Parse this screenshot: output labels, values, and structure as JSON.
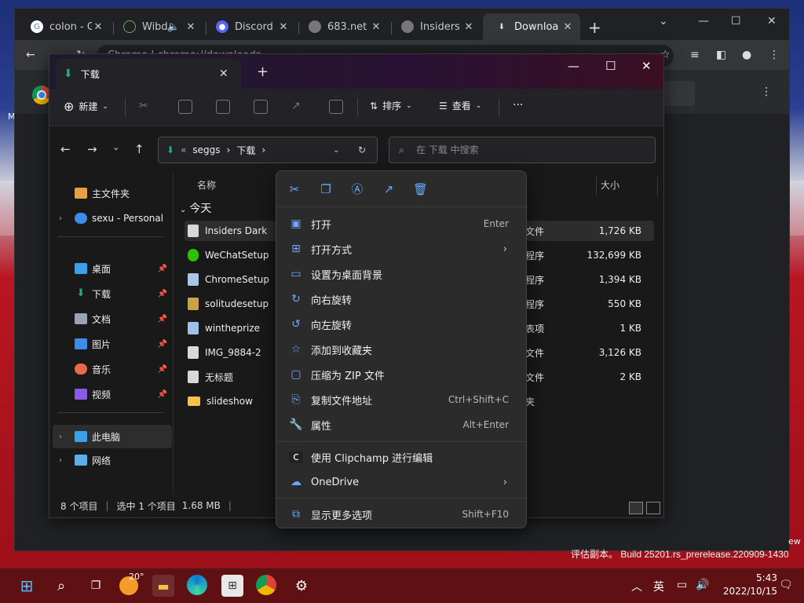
{
  "chrome": {
    "tabs": [
      {
        "label": "colon - G",
        "icon": "google-icon"
      },
      {
        "label": "Wibd",
        "icon": "wibdev-icon"
      },
      {
        "label": "Discord |",
        "icon": "discord-icon"
      },
      {
        "label": "683.net",
        "icon": "globe-icon"
      },
      {
        "label": "Insiders I",
        "icon": "globe-icon"
      },
      {
        "label": "Downloa",
        "icon": "download-icon"
      }
    ],
    "omnibox": "Chrome  |  chrome://downloads"
  },
  "explorer": {
    "tab_title": "下载",
    "toolbar": {
      "new_label": "新建",
      "sort_label": "排序",
      "view_label": "查看",
      "more_label": "···"
    },
    "breadcrumb": {
      "prefix": "«",
      "parts": [
        "seggs",
        "下载"
      ]
    },
    "search_placeholder": "在 下载 中搜索",
    "nav": {
      "home": "主文件夹",
      "onedrive": "sexu - Personal",
      "quick": [
        {
          "label": "桌面",
          "color": "#3aa0e8"
        },
        {
          "label": "下载",
          "color": "#1fb37a"
        },
        {
          "label": "文档",
          "color": "#9aa3b3"
        },
        {
          "label": "图片",
          "color": "#3a8ee8"
        },
        {
          "label": "音乐",
          "color": "#e86a4a"
        },
        {
          "label": "视频",
          "color": "#8a5ae8"
        }
      ],
      "thispc": "此电脑",
      "network": "网络"
    },
    "columns": {
      "name": "名称",
      "size": "大小"
    },
    "group": "今天",
    "files": [
      {
        "name": "Insiders Dark",
        "type": "文件",
        "size": "1,726 KB"
      },
      {
        "name": "WeChatSetup",
        "type": "程序",
        "size": "132,699 KB"
      },
      {
        "name": "ChromeSetup",
        "type": "程序",
        "size": "1,394 KB"
      },
      {
        "name": "solitudesetup",
        "type": "程序",
        "size": "550 KB"
      },
      {
        "name": "wintheprize",
        "type": "表项",
        "size": "1 KB"
      },
      {
        "name": "IMG_9884-2",
        "type": "文件",
        "size": "3,126 KB"
      },
      {
        "name": "无标题",
        "type": "文件",
        "size": "2 KB"
      },
      {
        "name": "slideshow",
        "type": "夹",
        "size": ""
      }
    ],
    "status": {
      "count": "8 个项目",
      "selected": "选中 1 个项目",
      "size": "1.68 MB"
    }
  },
  "context_menu": {
    "items": [
      {
        "label": "打开",
        "shortcut": "Enter",
        "icon": "image-icon"
      },
      {
        "label": "打开方式",
        "shortcut": "",
        "icon": "open-with-icon",
        "submenu": true
      },
      {
        "label": "设置为桌面背景",
        "shortcut": "",
        "icon": "wallpaper-icon"
      },
      {
        "label": "向右旋转",
        "shortcut": "",
        "icon": "rotate-right-icon"
      },
      {
        "label": "向左旋转",
        "shortcut": "",
        "icon": "rotate-left-icon"
      },
      {
        "label": "添加到收藏夹",
        "shortcut": "",
        "icon": "star-icon"
      },
      {
        "label": "压缩为 ZIP 文件",
        "shortcut": "",
        "icon": "zip-icon"
      },
      {
        "label": "复制文件地址",
        "shortcut": "Ctrl+Shift+C",
        "icon": "copy-path-icon"
      },
      {
        "label": "属性",
        "shortcut": "Alt+Enter",
        "icon": "properties-icon"
      }
    ],
    "extra": [
      {
        "label": "使用 Clipchamp 进行编辑",
        "shortcut": "",
        "icon": "clipchamp-icon"
      },
      {
        "label": "OneDrive",
        "shortcut": "",
        "icon": "onedrive-icon",
        "submenu": true
      }
    ],
    "more": {
      "label": "显示更多选项",
      "shortcut": "Shift+F10"
    }
  },
  "desktop": {
    "watermark": "评估副本。 Build 25201.rs_prerelease.220909-1430",
    "watermark_tail": "ew"
  },
  "taskbar": {
    "weather": "20°",
    "ime": "英",
    "time": "5:43",
    "date": "2022/10/15"
  }
}
